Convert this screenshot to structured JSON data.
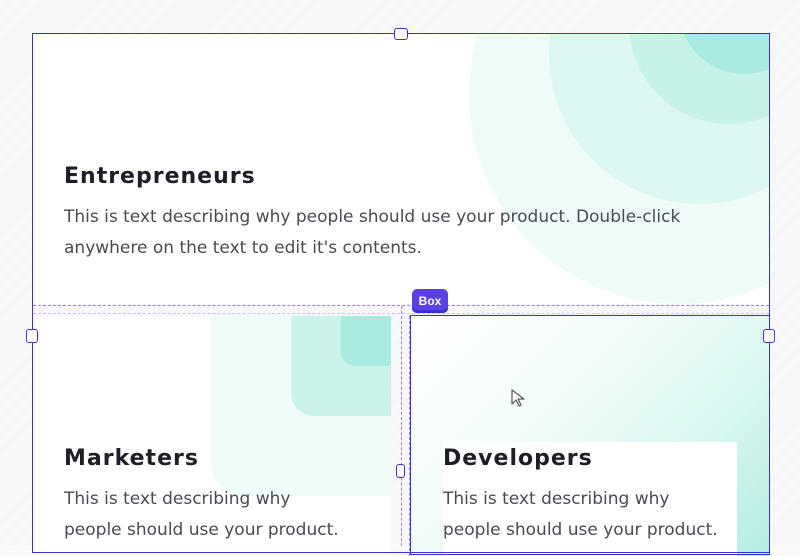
{
  "colors": {
    "selection": "#3b2fd6",
    "label_bg": "#5a41e6",
    "accent_teal": "#9ee9df",
    "text_dark": "#1e1e26",
    "text_body": "#4a4a55"
  },
  "cards": {
    "entrepreneurs": {
      "title": "Entrepreneurs",
      "desc_line1": "This is text describing why people should use your product. Double-click",
      "desc_line2": "anywhere on the text to edit it's contents."
    },
    "marketers": {
      "title": "Marketers",
      "desc_line1": "This is text describing why",
      "desc_line2": "people should use your product."
    },
    "developers": {
      "title": "Developers",
      "desc_line1": "This is text describing why",
      "desc_line2": "people should use your product."
    }
  },
  "selection": {
    "label": "Box"
  },
  "icons": {
    "cursor": "arrow-cursor-icon"
  }
}
